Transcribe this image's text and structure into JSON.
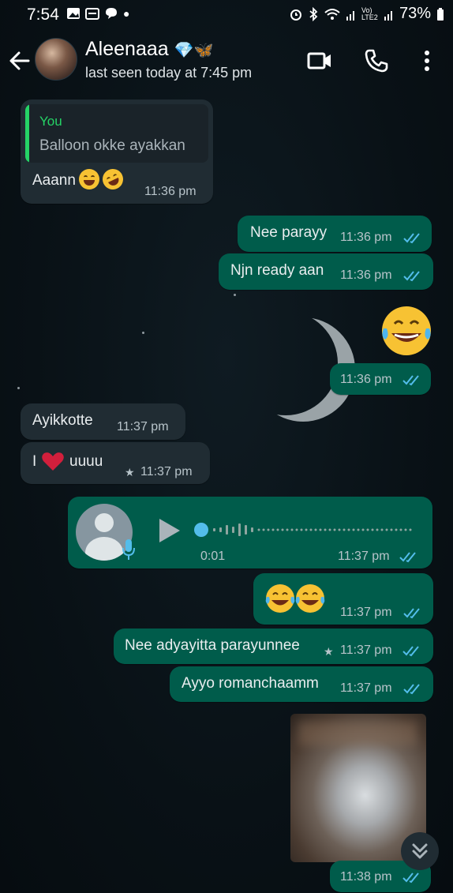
{
  "status_bar": {
    "time": "7:54",
    "network": "Vo) LTE2",
    "battery": "73%"
  },
  "header": {
    "contact_name": "Aleenaaa",
    "name_emojis": "💎🦋",
    "last_seen": "last seen today at 7:45 pm",
    "icons": [
      "back-arrow-icon",
      "video-call-icon",
      "phone-icon",
      "more-options-icon"
    ]
  },
  "messages": [
    {
      "dir": "in",
      "quote_author": "You",
      "quote_text": "Balloon okke ayakkan",
      "text": "Aaann",
      "time": "11:36 pm"
    },
    {
      "dir": "out",
      "text": "Nee parayy",
      "time": "11:36 pm",
      "status": "read"
    },
    {
      "dir": "out",
      "text": "Njn ready aan",
      "time": "11:36 pm",
      "status": "read"
    },
    {
      "dir": "out",
      "text": "",
      "emoji": "face-with-tears-of-joy",
      "time": "11:36 pm",
      "status": "read"
    },
    {
      "dir": "in",
      "text": "Ayikkotte",
      "time": "11:37 pm"
    },
    {
      "dir": "in",
      "text_before": "I",
      "text_after": "uuuu",
      "time": "11:37 pm",
      "starred": true
    },
    {
      "dir": "out",
      "type": "voice",
      "duration": "0:01",
      "time": "11:37 pm",
      "status": "read"
    },
    {
      "dir": "out",
      "text": "",
      "emoji": "face-with-tears-of-joy x2",
      "time": "11:37 pm",
      "status": "read"
    },
    {
      "dir": "out",
      "text": "Nee adyayitta parayunnee",
      "time": "11:37 pm",
      "status": "read",
      "starred": true
    },
    {
      "dir": "out",
      "text": "Ayyo romanchaamm",
      "time": "11:37 pm",
      "status": "read"
    },
    {
      "dir": "out",
      "type": "image",
      "time": "11:38 pm",
      "status": "read"
    }
  ],
  "colors": {
    "background": "#0b141a",
    "incoming_bubble": "#202c33",
    "outgoing_bubble": "#005c4b",
    "read_ticks": "#53bdeb",
    "quote_bar": "#25d366"
  }
}
